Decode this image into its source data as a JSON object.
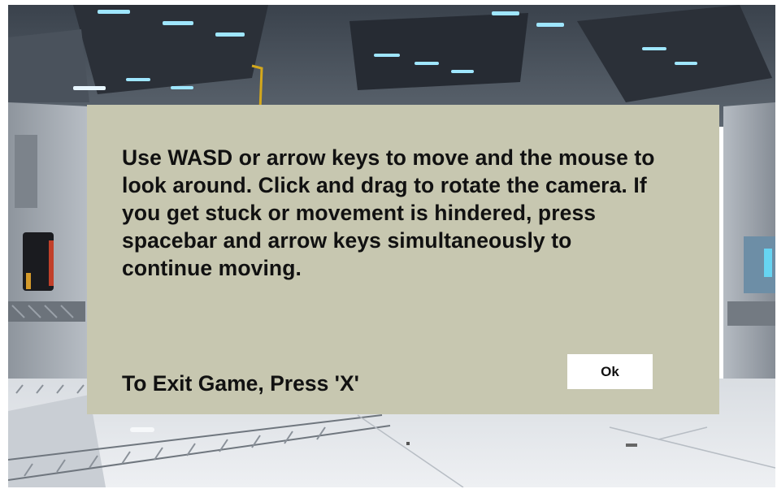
{
  "dialog": {
    "message": "Use WASD or arrow keys to move and the mouse to look around. Click and drag to rotate the camera. If you get stuck or movement is hindered, press spacebar and arrow keys simultaneously to continue moving.",
    "exit_hint": "To Exit Game, Press 'X'",
    "ok_label": "Ok",
    "background_color": "#c7c7b0"
  }
}
